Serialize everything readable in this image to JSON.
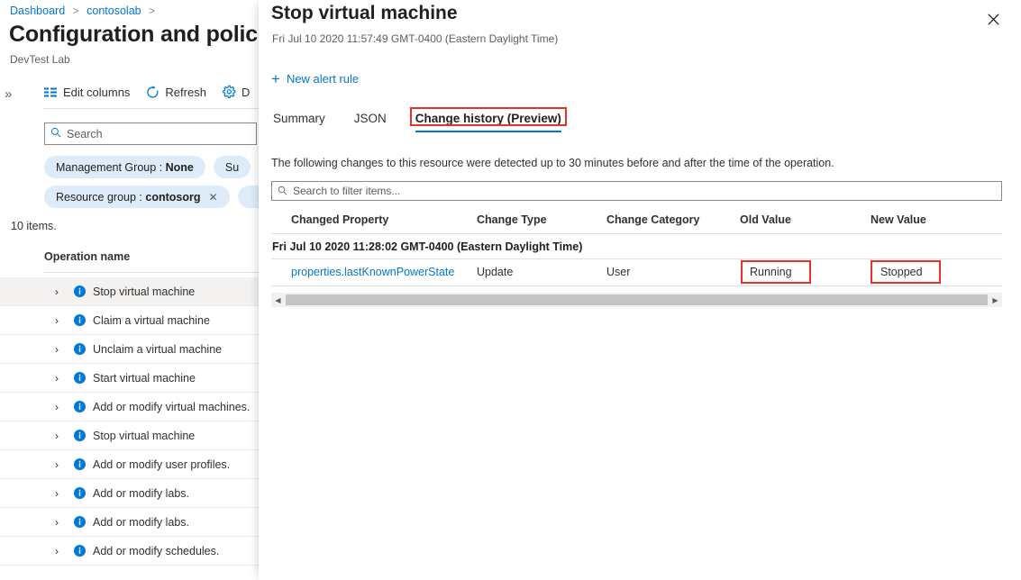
{
  "left_blade": {
    "breadcrumb": [
      "Dashboard",
      "contosolab"
    ],
    "title": "Configuration and policies",
    "subtitle": "DevTest Lab",
    "collapse_icon": "double-chevron-right-icon",
    "toolbar": [
      {
        "label": "Edit columns",
        "icon": "columns-icon"
      },
      {
        "label": "Refresh",
        "icon": "refresh-icon"
      },
      {
        "label": "D",
        "icon": "gear-icon"
      }
    ],
    "search": {
      "placeholder": "Search",
      "value": "",
      "icon": "search-icon"
    },
    "pills": [
      [
        {
          "label": "Management Group :",
          "value": "None",
          "removable": false
        },
        {
          "label": "Su",
          "value": "",
          "removable": false
        }
      ],
      [
        {
          "label": "Resource group :",
          "value": "contosorg",
          "removable": true
        }
      ]
    ],
    "items_count": "10 items.",
    "column_header": "Operation name",
    "operations": [
      {
        "label": "Stop virtual machine",
        "selected": true
      },
      {
        "label": "Claim a virtual machine",
        "selected": false
      },
      {
        "label": "Unclaim a virtual machine",
        "selected": false
      },
      {
        "label": "Start virtual machine",
        "selected": false
      },
      {
        "label": "Add or modify virtual machines.",
        "selected": false
      },
      {
        "label": "Stop virtual machine",
        "selected": false
      },
      {
        "label": "Add or modify user profiles.",
        "selected": false
      },
      {
        "label": "Add or modify labs.",
        "selected": false
      },
      {
        "label": "Add or modify labs.",
        "selected": false
      },
      {
        "label": "Add or modify schedules.",
        "selected": false
      }
    ]
  },
  "right_pane": {
    "title": "Stop virtual machine",
    "timestamp": "Fri Jul 10 2020 11:57:49 GMT-0400 (Eastern Daylight Time)",
    "close_label": "Close",
    "command": {
      "label": "New alert rule",
      "icon": "plus-icon"
    },
    "tabs": [
      {
        "label": "Summary",
        "active": false,
        "highlighted": false
      },
      {
        "label": "JSON",
        "active": false,
        "highlighted": false
      },
      {
        "label": "Change history (Preview)",
        "active": true,
        "highlighted": true
      }
    ],
    "description": "The following changes to this resource were detected up to 30 minutes before and after the time of the operation.",
    "filter": {
      "placeholder": "Search to filter items...",
      "value": "",
      "icon": "search-icon"
    },
    "grid": {
      "columns": [
        "Changed Property",
        "Change Type",
        "Change Category",
        "Old Value",
        "New Value"
      ],
      "group_label": "Fri Jul 10 2020 11:28:02 GMT-0400 (Eastern Daylight Time)",
      "rows": [
        {
          "changed_property": "properties.lastKnownPowerState",
          "change_type": "Update",
          "change_category": "User",
          "old_value": "Running",
          "new_value": "Stopped"
        }
      ]
    },
    "scrollbar": {
      "left_arrow": "◀",
      "right_arrow": "▶"
    }
  },
  "colors": {
    "accent": "#0078d4",
    "annotation_red": "#e8312a",
    "pill_bg": "#deecf9",
    "selected_row_bg": "#f3f2f1"
  }
}
